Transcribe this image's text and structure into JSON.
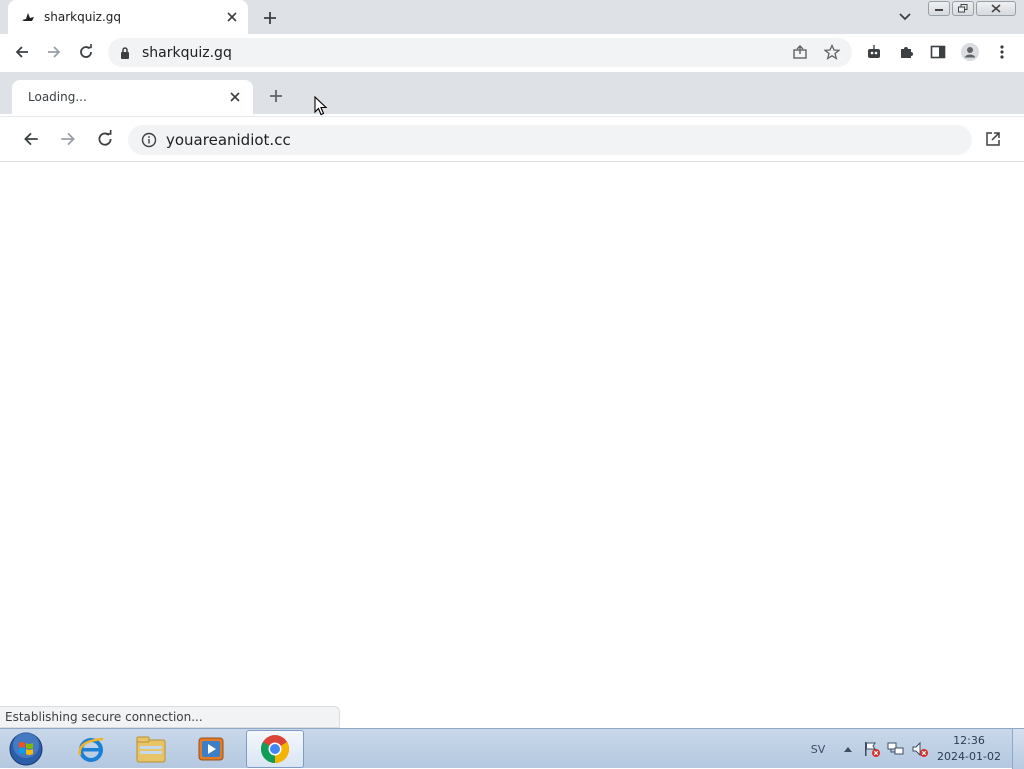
{
  "outer_browser": {
    "tab": {
      "title": "sharkquiz.gq"
    },
    "omnibox": {
      "url": "sharkquiz.gq"
    },
    "icons": [
      "back-icon",
      "forward-icon",
      "reload-icon",
      "lock-icon",
      "share-icon",
      "star-icon",
      "robot-extension-icon",
      "puzzle-extensions-icon",
      "side-panel-icon",
      "profile-icon",
      "kebab-menu-icon"
    ]
  },
  "popup_window": {
    "tab": {
      "title": "Loading..."
    },
    "omnibox": {
      "url": "youareanidiot.cc"
    },
    "status_text": "Establishing secure connection..."
  },
  "taskbar": {
    "apps": [
      "internet-explorer",
      "file-explorer",
      "media-player",
      "chrome"
    ],
    "language": "SV",
    "time": "12:36",
    "date": "2024-01-02"
  },
  "colors": {
    "tabstrip": "#dee1e6",
    "omnibox_bg": "#f1f3f4",
    "text": "#202124",
    "taskbar": "#c9d8ea"
  }
}
